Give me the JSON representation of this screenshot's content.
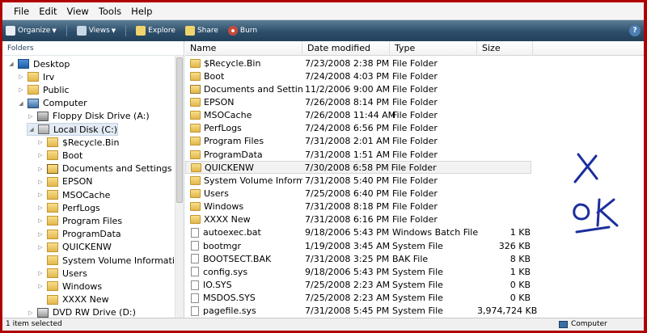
{
  "menu": [
    "File",
    "Edit",
    "View",
    "Tools",
    "Help"
  ],
  "toolbar": {
    "organize": "Organize",
    "views": "Views",
    "explore": "Explore",
    "share": "Share",
    "burn": "Burn"
  },
  "nav": {
    "header": "Folders",
    "tree": [
      {
        "label": "Desktop",
        "indent": 0,
        "expander": "open",
        "icon": "desktop"
      },
      {
        "label": "Irv",
        "indent": 1,
        "expander": "closed",
        "icon": "user-folder"
      },
      {
        "label": "Public",
        "indent": 1,
        "expander": "closed",
        "icon": "folder"
      },
      {
        "label": "Computer",
        "indent": 1,
        "expander": "open",
        "icon": "computer"
      },
      {
        "label": "Floppy Disk Drive (A:)",
        "indent": 2,
        "expander": "closed",
        "icon": "floppy"
      },
      {
        "label": "Local Disk (C:)",
        "indent": 2,
        "expander": "open",
        "icon": "drive",
        "selected": true
      },
      {
        "label": "$Recycle.Bin",
        "indent": 3,
        "expander": "closed",
        "icon": "folder"
      },
      {
        "label": "Boot",
        "indent": 3,
        "expander": "closed",
        "icon": "folder"
      },
      {
        "label": "Documents and Settings",
        "indent": 3,
        "expander": "closed",
        "icon": "shortcut-folder"
      },
      {
        "label": "EPSON",
        "indent": 3,
        "expander": "closed",
        "icon": "folder"
      },
      {
        "label": "MSOCache",
        "indent": 3,
        "expander": "closed",
        "icon": "folder"
      },
      {
        "label": "PerfLogs",
        "indent": 3,
        "expander": "closed",
        "icon": "folder"
      },
      {
        "label": "Program Files",
        "indent": 3,
        "expander": "closed",
        "icon": "folder"
      },
      {
        "label": "ProgramData",
        "indent": 3,
        "expander": "closed",
        "icon": "folder"
      },
      {
        "label": "QUICKENW",
        "indent": 3,
        "expander": "closed",
        "icon": "folder"
      },
      {
        "label": "System Volume Information",
        "indent": 3,
        "expander": "none",
        "icon": "folder"
      },
      {
        "label": "Users",
        "indent": 3,
        "expander": "closed",
        "icon": "folder"
      },
      {
        "label": "Windows",
        "indent": 3,
        "expander": "closed",
        "icon": "folder"
      },
      {
        "label": "XXXX New",
        "indent": 3,
        "expander": "none",
        "icon": "folder"
      },
      {
        "label": "DVD RW Drive (D:)",
        "indent": 2,
        "expander": "closed",
        "icon": "dvd"
      }
    ]
  },
  "columns": {
    "name": "Name",
    "date": "Date modified",
    "type": "Type",
    "size": "Size"
  },
  "files": [
    {
      "name": "$Recycle.Bin",
      "date": "7/23/2008 2:38 PM",
      "type": "File Folder",
      "size": "",
      "icon": "folder"
    },
    {
      "name": "Boot",
      "date": "7/24/2008 4:03 PM",
      "type": "File Folder",
      "size": "",
      "icon": "folder"
    },
    {
      "name": "Documents and Settings",
      "date": "11/2/2006 9:00 AM",
      "type": "File Folder",
      "size": "",
      "icon": "shortcut-folder"
    },
    {
      "name": "EPSON",
      "date": "7/26/2008 8:14 PM",
      "type": "File Folder",
      "size": "",
      "icon": "folder"
    },
    {
      "name": "MSOCache",
      "date": "7/26/2008 11:44 AM",
      "type": "File Folder",
      "size": "",
      "icon": "folder"
    },
    {
      "name": "PerfLogs",
      "date": "7/24/2008 6:56 PM",
      "type": "File Folder",
      "size": "",
      "icon": "folder"
    },
    {
      "name": "Program Files",
      "date": "7/31/2008 2:01 AM",
      "type": "File Folder",
      "size": "",
      "icon": "folder"
    },
    {
      "name": "ProgramData",
      "date": "7/31/2008 1:51 AM",
      "type": "File Folder",
      "size": "",
      "icon": "folder"
    },
    {
      "name": "QUICKENW",
      "date": "7/30/2008 6:58 PM",
      "type": "File Folder",
      "size": "",
      "icon": "folder",
      "hover": true
    },
    {
      "name": "System Volume Informati...",
      "date": "7/31/2008 5:40 PM",
      "type": "File Folder",
      "size": "",
      "icon": "folder"
    },
    {
      "name": "Users",
      "date": "7/25/2008 6:40 PM",
      "type": "File Folder",
      "size": "",
      "icon": "folder"
    },
    {
      "name": "Windows",
      "date": "7/31/2008 8:18 PM",
      "type": "File Folder",
      "size": "",
      "icon": "folder"
    },
    {
      "name": "XXXX New",
      "date": "7/31/2008 6:16 PM",
      "type": "File Folder",
      "size": "",
      "icon": "folder"
    },
    {
      "name": "autoexec.bat",
      "date": "9/18/2006 5:43 PM",
      "type": "Windows Batch File",
      "size": "1 KB",
      "icon": "file"
    },
    {
      "name": "bootmgr",
      "date": "1/19/2008 3:45 AM",
      "type": "System File",
      "size": "326 KB",
      "icon": "file"
    },
    {
      "name": "BOOTSECT.BAK",
      "date": "7/31/2008 3:25 PM",
      "type": "BAK File",
      "size": "8 KB",
      "icon": "file"
    },
    {
      "name": "config.sys",
      "date": "9/18/2006 5:43 PM",
      "type": "System File",
      "size": "1 KB",
      "icon": "file"
    },
    {
      "name": "IO.SYS",
      "date": "7/25/2008 2:23 AM",
      "type": "System File",
      "size": "0 KB",
      "icon": "file"
    },
    {
      "name": "MSDOS.SYS",
      "date": "7/25/2008 2:23 AM",
      "type": "System File",
      "size": "0 KB",
      "icon": "file"
    },
    {
      "name": "pagefile.sys",
      "date": "7/31/2008 5:45 PM",
      "type": "System File",
      "size": "3,974,724 KB",
      "icon": "file"
    }
  ],
  "status": {
    "count": "1 item selected",
    "location": "Computer"
  },
  "colors": {
    "frame": "#b00000",
    "toolbar": "#2e4f6a",
    "scribble": "#1c2f9e"
  }
}
